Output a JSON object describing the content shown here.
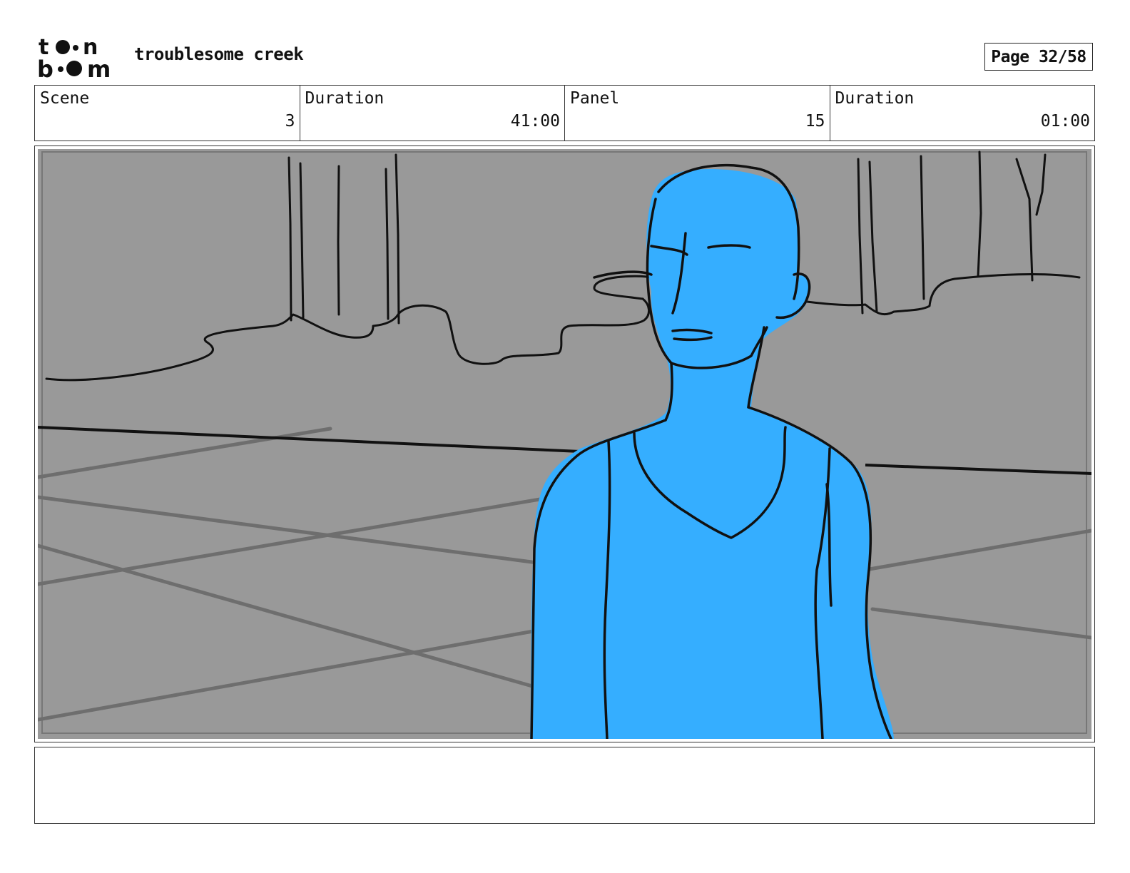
{
  "header": {
    "logo_text": "toon boom",
    "project_title": "troublesome creek",
    "page_label": "Page 32/58"
  },
  "info": {
    "scene_label": "Scene",
    "scene_value": "3",
    "scene_duration_label": "Duration",
    "scene_duration_value": "41:00",
    "panel_label": "Panel",
    "panel_value": "15",
    "panel_duration_label": "Duration",
    "panel_duration_value": "01:00"
  },
  "panel": {
    "background_color": "#999999",
    "figure_color": "#35AEFF",
    "line_color": "#111111"
  },
  "notes": {
    "text": ""
  }
}
